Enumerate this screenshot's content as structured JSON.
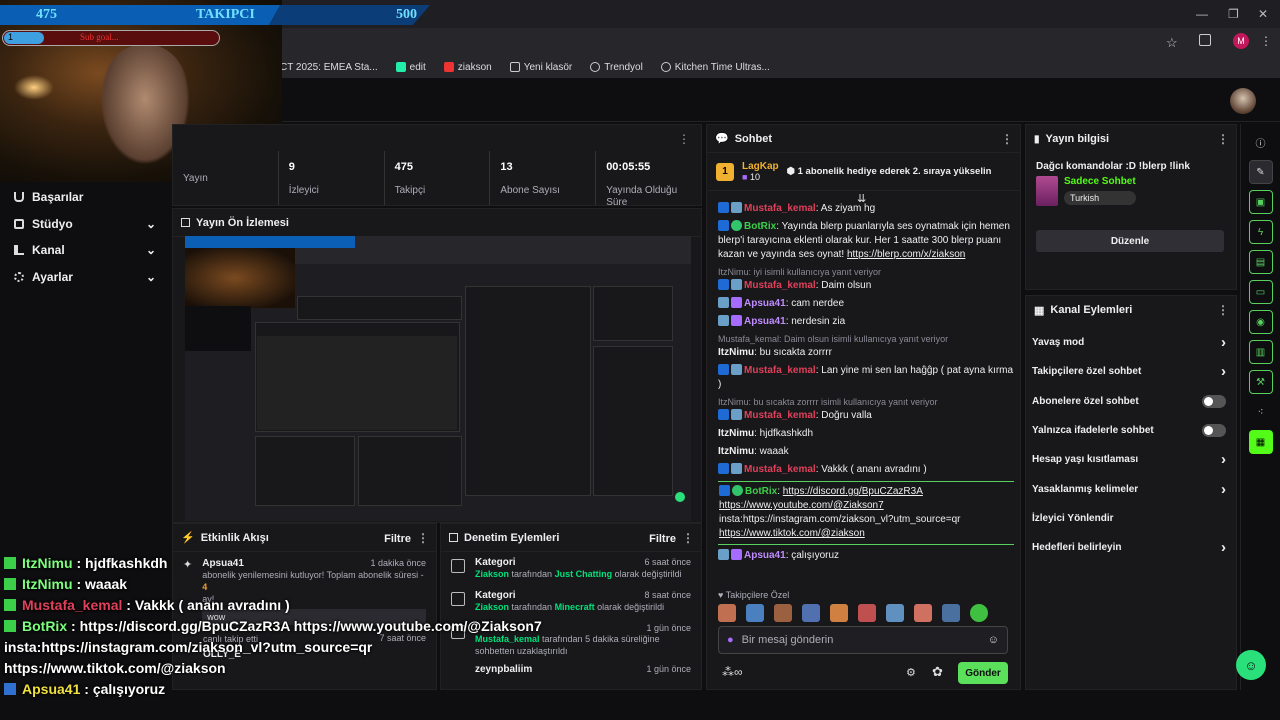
{
  "goal": {
    "current": "475",
    "label": "TAKIPCI",
    "target": "500"
  },
  "sub_goal": {
    "current": "1",
    "label": "Sub goal..."
  },
  "bookmarks": [
    "CT 2025: EMEA Sta...",
    "edit",
    "ziakson",
    "Yeni klasör",
    "Trendyol",
    "Kitchen Time Ultras..."
  ],
  "window": {
    "min": "—",
    "max": "❐",
    "close": "✕"
  },
  "nav": [
    {
      "label": "Başarılar",
      "chev": ""
    },
    {
      "label": "Stüdyo",
      "chev": "⌄"
    },
    {
      "label": "Kanal",
      "chev": "⌄"
    },
    {
      "label": "Ayarlar",
      "chev": "⌄"
    }
  ],
  "stats": [
    {
      "value": "",
      "label": "Yayın"
    },
    {
      "value": "9",
      "label": "İzleyici"
    },
    {
      "value": "475",
      "label": "Takipçi"
    },
    {
      "value": "13",
      "label": "Abone Sayısı"
    },
    {
      "value": "00:05:55",
      "label": "Yayında Olduğu Süre"
    }
  ],
  "preview": {
    "title": "Yayın Ön İzlemesi"
  },
  "activity": {
    "title": "Etkinlik Akışı",
    "filter": "Filtre",
    "items": [
      {
        "user": "Apsua41",
        "time": "1 dakika önce",
        "text": "abonelik yenilemesini kutluyor! Toplam abonelik süresi - ",
        "months": "4",
        "text2": "ay!"
      },
      {
        "user": "",
        "time": "",
        "text": "wow",
        "months": "",
        "text2": ""
      },
      {
        "user": "",
        "time": "7 saat önce",
        "text": "canlı takip etti",
        "months": "",
        "text2": ""
      },
      {
        "user": "OLLY_E",
        "time": "",
        "text": "",
        "months": "",
        "text2": ""
      }
    ]
  },
  "mod_actions": {
    "title": "Denetim Eylemleri",
    "filter": "Filtre",
    "items": [
      {
        "title": "Kategori",
        "time": "6 saat önce",
        "user": "Ziakson",
        "mid": " tarafından ",
        "value": "Just Chatting",
        "tail": " olarak değiştirildi"
      },
      {
        "title": "Kategori",
        "time": "8 saat önce",
        "user": "Ziakson",
        "mid": " tarafından ",
        "value": "Minecraft",
        "tail": " olarak değiştirildi"
      },
      {
        "title": "",
        "time": "1 gün önce",
        "user": "Mustafa_kemal",
        "mid": " tarafından 5 dakika süreliğine sohbetten uzaklaştırıldı",
        "value": "",
        "tail": ""
      },
      {
        "title": "zeynpbaliim",
        "time": "1 gün önce",
        "user": "",
        "mid": "",
        "value": "",
        "tail": ""
      }
    ]
  },
  "chat": {
    "title": "Sohbet",
    "pinned_user": "LagKap",
    "pinned_count": "10",
    "pinned_text": "1 abonelik hediye ederek 2. sıraya yükselin",
    "messages": [
      {
        "type": "msg",
        "name": "Mustafa_kemal",
        "color": "red",
        "badges": [
          "blue",
          "sword"
        ],
        "text": "As ziyam hg"
      },
      {
        "type": "msg",
        "name": "BotRix",
        "color": "green",
        "badges": [
          "blue",
          "green"
        ],
        "text": "Yayında blerp puanlarıyla ses oynatmak için hemen blerp'i tarayıcına eklenti olarak kur. Her 1 saatte 300 blerp puanı kazan ve yayında ses oynat! ",
        "link": "https://blerp.com/x/ziakson"
      },
      {
        "type": "reply",
        "text": "ItzNimu: iyi isimli kullanıcıya yanıt veriyor"
      },
      {
        "type": "msg",
        "name": "Mustafa_kemal",
        "color": "red",
        "badges": [
          "blue",
          "sword"
        ],
        "text": "Daim olsun"
      },
      {
        "type": "msg",
        "name": "Apsua41",
        "color": "purple",
        "badges": [
          "sword",
          "purple"
        ],
        "text": "cam nerdee"
      },
      {
        "type": "msg",
        "name": "Apsua41",
        "color": "purple",
        "badges": [
          "sword",
          "purple"
        ],
        "text": "nerdesin zia"
      },
      {
        "type": "reply",
        "text": "Mustafa_kemal: Daim olsun isimli kullanıcıya yanıt veriyor"
      },
      {
        "type": "msg",
        "name": "ItzNimu",
        "color": "white",
        "badges": [],
        "text": "bu sıcakta zorrrr"
      },
      {
        "type": "msg",
        "name": "Mustafa_kemal",
        "color": "red",
        "badges": [
          "blue",
          "sword"
        ],
        "text": "Lan yine mi sen lan haĝĝp ( pat ayna kırma )"
      },
      {
        "type": "reply",
        "text": "ItzNimu: bu sıcakta zorrrr isimli kullanıcıya yanıt veriyor"
      },
      {
        "type": "msg",
        "name": "Mustafa_kemal",
        "color": "red",
        "badges": [
          "blue",
          "sword"
        ],
        "text": "Doğru valla"
      },
      {
        "type": "msg",
        "name": "ItzNimu",
        "color": "white",
        "badges": [],
        "text": "hjdfkashkdh"
      },
      {
        "type": "msg",
        "name": "ItzNimu",
        "color": "white",
        "badges": [],
        "text": "waaak"
      },
      {
        "type": "msg",
        "name": "Mustafa_kemal",
        "color": "red",
        "badges": [
          "blue",
          "sword"
        ],
        "text": "Vakkk ( ananı avradını )"
      }
    ],
    "highlight": {
      "name": "BotRix",
      "lines": [
        "https://discord.gg/BpuCZazR3A",
        "https://www.youtube.com/@Ziakson7",
        "insta:https://instagram.com/ziakson_vl?utm_source=qr",
        "https://www.tiktok.com/@ziakson"
      ]
    },
    "last": {
      "name": "Apsua41",
      "text": "çalışıyoruz"
    },
    "followers_label": "Takipçilere Özel",
    "input_placeholder": "Bir mesaj gönderin",
    "send": "Gönder"
  },
  "stream_info": {
    "title": "Yayın bilgisi",
    "stream_title": "Dağcı komandolar :D !blerp !link",
    "category": "Sadece Sohbet",
    "tag": "Turkish",
    "edit": "Düzenle"
  },
  "channel_actions": {
    "title": "Kanal Eylemleri",
    "items": [
      {
        "label": "Yavaş mod",
        "ctrl": "chev"
      },
      {
        "label": "Takipçilere özel sohbet",
        "ctrl": "chev"
      },
      {
        "label": "Abonelere özel sohbet",
        "ctrl": "toggle"
      },
      {
        "label": "Yalnızca ifadelerle sohbet",
        "ctrl": "toggle"
      },
      {
        "label": "Hesap yaşı kısıtlaması",
        "ctrl": "chev"
      },
      {
        "label": "Yasaklanmış kelimeler",
        "ctrl": "chev"
      },
      {
        "label": "İzleyici Yönlendir",
        "ctrl": "none"
      },
      {
        "label": "Hedefleri belirleyin",
        "ctrl": "chev"
      }
    ]
  },
  "overlay": [
    {
      "name": "ItzNimu",
      "sep": " : ",
      "text": "hjdfkashkdh"
    },
    {
      "name": "ItzNimu",
      "sep": " : ",
      "text": "waaak"
    },
    {
      "name": "Mustafa_kemal",
      "sep": " : ",
      "text": "Vakkk ( ananı avradını )"
    },
    {
      "name": "BotRix",
      "sep": " : ",
      "text": "https://discord.gg/BpuCZazR3A https://www.youtube.com/@Ziakson7"
    },
    {
      "name": "",
      "sep": "",
      "text": "insta:https://instagram.com/ziakson_vl?utm_source=qr"
    },
    {
      "name": "",
      "sep": "",
      "text": "https://www.tiktok.com/@ziakson"
    },
    {
      "name": "Apsua41",
      "sep": " : ",
      "text": "çalışıyoruz"
    }
  ],
  "colors": {
    "accent": "#53fc18",
    "panel": "#18181b",
    "bg": "#0e0e10",
    "name_red": "#e0405a",
    "name_green": "#3cd04a",
    "name_purple": "#c08cff"
  }
}
